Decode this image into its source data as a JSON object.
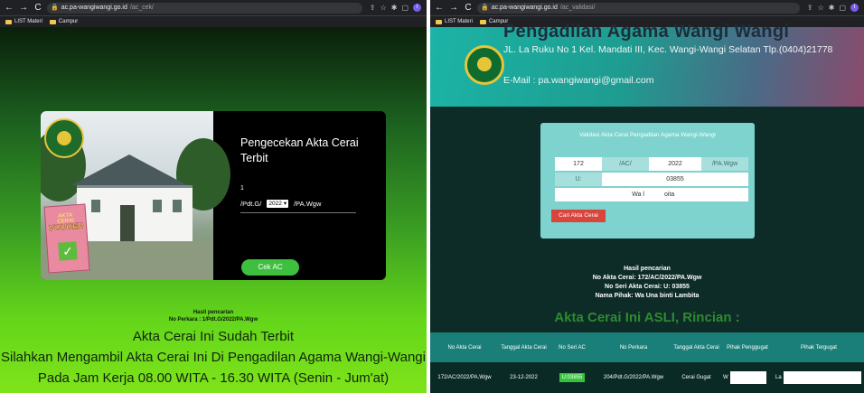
{
  "left": {
    "url_host": "ac.pa-wangiwangi.go.id",
    "url_path": "/ac_cek/",
    "bookmarks": [
      "LIST Materi",
      "Campur"
    ],
    "book_cover_top": "AKTA CERAI",
    "book_cover_main": "VOUCER",
    "card_title": "Pengecekan Akta Cerai Terbit",
    "perkara_number": "1",
    "pdt_prefix": "/Pdt.G/",
    "year_selected": "2022",
    "pa_suffix": "/PA.Wgw",
    "cek_button": "Cek AC",
    "hasil_label": "Hasil pencarian",
    "no_perkara": "No Perkara : 1/Pdt.G/2022/PA.Wgw",
    "line1": "Akta Cerai Ini Sudah Terbit",
    "line2": "Silahkan Mengambil Akta Cerai Ini Di Pengadilan Agama Wangi-Wangi",
    "line3": "Pada Jam Kerja 08.00 WITA - 16.30 WITA (Senin - Jum'at)"
  },
  "right": {
    "url_host": "ac.pa-wangiwangi.go.id",
    "url_path": "/ac_validasi/",
    "bookmarks": [
      "LIST Materi",
      "Campur"
    ],
    "banner_title": "Pengadilan Agama Wangi Wangi",
    "banner_address": "JL. La Ruku No 1 Kel. Mandati III, Kec. Wangi-Wangi Selatan Tlp.(0404)21778",
    "banner_email": "E-Mail : pa.wangiwangi@gmail.com",
    "validasi_title": "Validasi Akta Cerai Pengadilan Agama Wangi-Wangi",
    "field_number": "172",
    "field_ac": "/AC/",
    "field_year": "2022",
    "field_pa": "/PA.Wgw",
    "field_u_label": "U:",
    "field_u_value": "03855",
    "field_name_a": "Wa l",
    "field_name_b": "oita",
    "cari_button": "Cari Akta Cerai",
    "hasil_label": "Hasil pencarian",
    "no_akta": "No Akta Cerai: 172/AC/2022/PA.Wgw",
    "no_seri": "No Seri Akta Cerai: U: 03855",
    "nama_pihak": "Nama Pihak: Wa Una binti Lambita",
    "asli_text": "Akta Cerai Ini ASLI, Rincian :",
    "table_headers": [
      "No Akta Cerai",
      "Tanggal Akta Cerai",
      "No Seri AC",
      "No Perkara",
      "Tanggal Akta Cerai",
      "Pihak Penggugat",
      "Pihak Tergugat"
    ],
    "row": {
      "no_akta": "172/AC/2022/PA.Wgw",
      "tanggal": "23-12-2022",
      "seri": "U:03855",
      "perkara": "204/Pdt.G/2022/PA.Wgw",
      "jenis": "Cerai Gugat",
      "penggugat": "W",
      "tergugat": "La"
    }
  },
  "colors": {
    "left_bg_top": "#0a1f0a",
    "left_bg_bottom": "#7fe31a",
    "right_bg": "#0d2b27",
    "banner_teal": "#1bb4a6",
    "cari_red": "#d9453d",
    "seri_green": "#35c33a"
  }
}
